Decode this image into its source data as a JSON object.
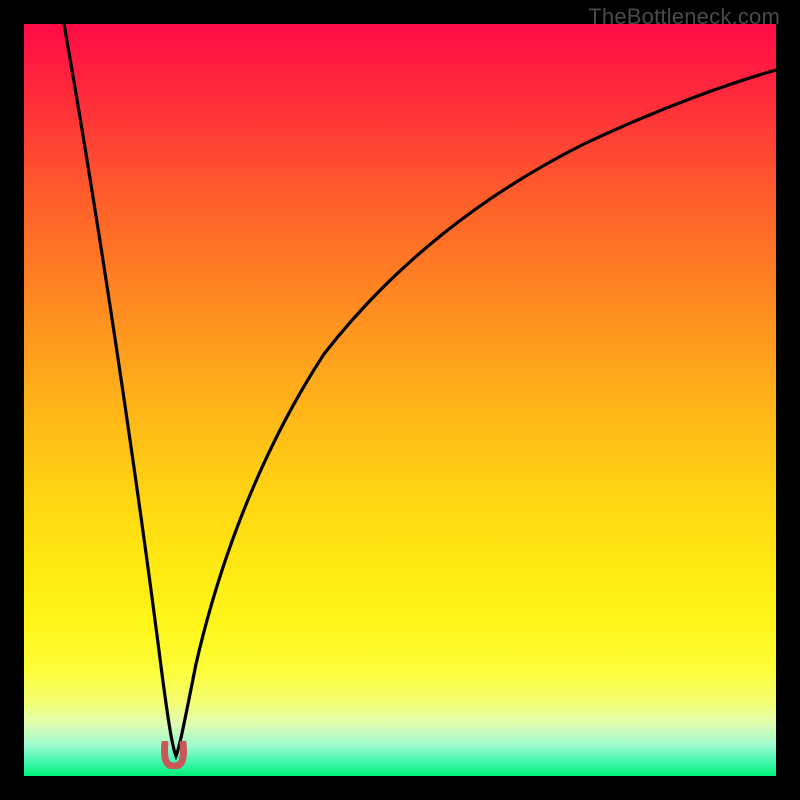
{
  "watermark": "TheBottleneck.com",
  "colors": {
    "frame_bg": "#000000",
    "curve_stroke": "#000000",
    "marker_fill": "#c85858",
    "gradient_top": "#ff0b46",
    "gradient_bottom": "#00f07a"
  },
  "chart_data": {
    "type": "line",
    "title": "",
    "xlabel": "",
    "ylabel": "",
    "xlim": [
      0,
      100
    ],
    "ylim": [
      0,
      100
    ],
    "series": [
      {
        "name": "bottleneck-curve",
        "x": [
          0,
          4,
          8,
          12,
          16,
          18,
          19,
          20,
          21,
          22,
          24,
          28,
          34,
          42,
          52,
          64,
          78,
          92,
          100
        ],
        "y": [
          100,
          80,
          60,
          40,
          20,
          8,
          2,
          0,
          2,
          8,
          22,
          40,
          55,
          68,
          78,
          85,
          90,
          93,
          94
        ]
      }
    ],
    "minimum_marker": {
      "x": 20,
      "y": 0
    },
    "annotations": []
  }
}
